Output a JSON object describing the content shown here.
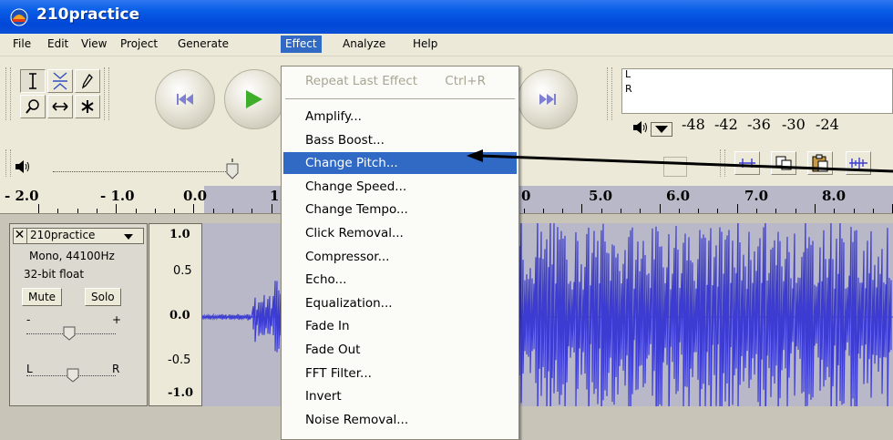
{
  "window": {
    "title": "210practice",
    "icon": "audacity-app-icon"
  },
  "menubar": {
    "items": [
      {
        "label": "File"
      },
      {
        "label": "Edit"
      },
      {
        "label": "View"
      },
      {
        "label": "Project"
      },
      {
        "label": "Generate"
      },
      {
        "label": "Effect",
        "active": true
      },
      {
        "label": "Analyze"
      },
      {
        "label": "Help"
      }
    ]
  },
  "tools": {
    "row1": [
      "selection-tool-icon",
      "envelope-tool-icon",
      "draw-tool-icon"
    ],
    "row2": [
      "zoom-tool-icon",
      "timeshift-tool-icon",
      "multi-tool-icon"
    ]
  },
  "transport": [
    "skip-to-start-icon",
    "play-icon",
    "skip-to-end-icon"
  ],
  "meter": {
    "left_label": "L",
    "right_label": "R",
    "scale": [
      "-48",
      "-42",
      "-36",
      "-30",
      "-24"
    ],
    "speaker_icon": "speaker-icon"
  },
  "mixer": {
    "speaker_icon": "speaker-icon"
  },
  "edit_toolbar": [
    "trim-icon",
    "copy-icon",
    "paste-icon",
    "silence-icon"
  ],
  "ruler": {
    "labels": [
      "- 2.0",
      "- 1.0",
      "0.0",
      "1",
      "0",
      "5.0",
      "6.0",
      "7.0",
      "8.0"
    ]
  },
  "track": {
    "name": "210practice",
    "format_line1": "Mono, 44100Hz",
    "format_line2": "32-bit float",
    "mute_label": "Mute",
    "solo_label": "Solo",
    "gain_minus": "-",
    "gain_plus": "+",
    "pan_left": "L",
    "pan_right": "R",
    "amplitude_scale": [
      "1.0",
      "0.5",
      "0.0",
      "-0.5",
      "-1.0"
    ],
    "wave_color": "#3c3cd2"
  },
  "effect_menu": {
    "repeat": {
      "label": "Repeat Last Effect",
      "shortcut": "Ctrl+R",
      "enabled": false
    },
    "items": [
      "Amplify...",
      "Bass Boost...",
      "Change Pitch...",
      "Change Speed...",
      "Change Tempo...",
      "Click Removal...",
      "Compressor...",
      "Echo...",
      "Equalization...",
      "Fade In",
      "Fade Out",
      "FFT Filter...",
      "Invert",
      "Noise Removal..."
    ],
    "highlighted": "Change Pitch..."
  },
  "colors": {
    "titlebar": "#0a5ee8",
    "highlight": "#316ac5",
    "selection": "#b8b8c8",
    "arrow": "#000000"
  }
}
